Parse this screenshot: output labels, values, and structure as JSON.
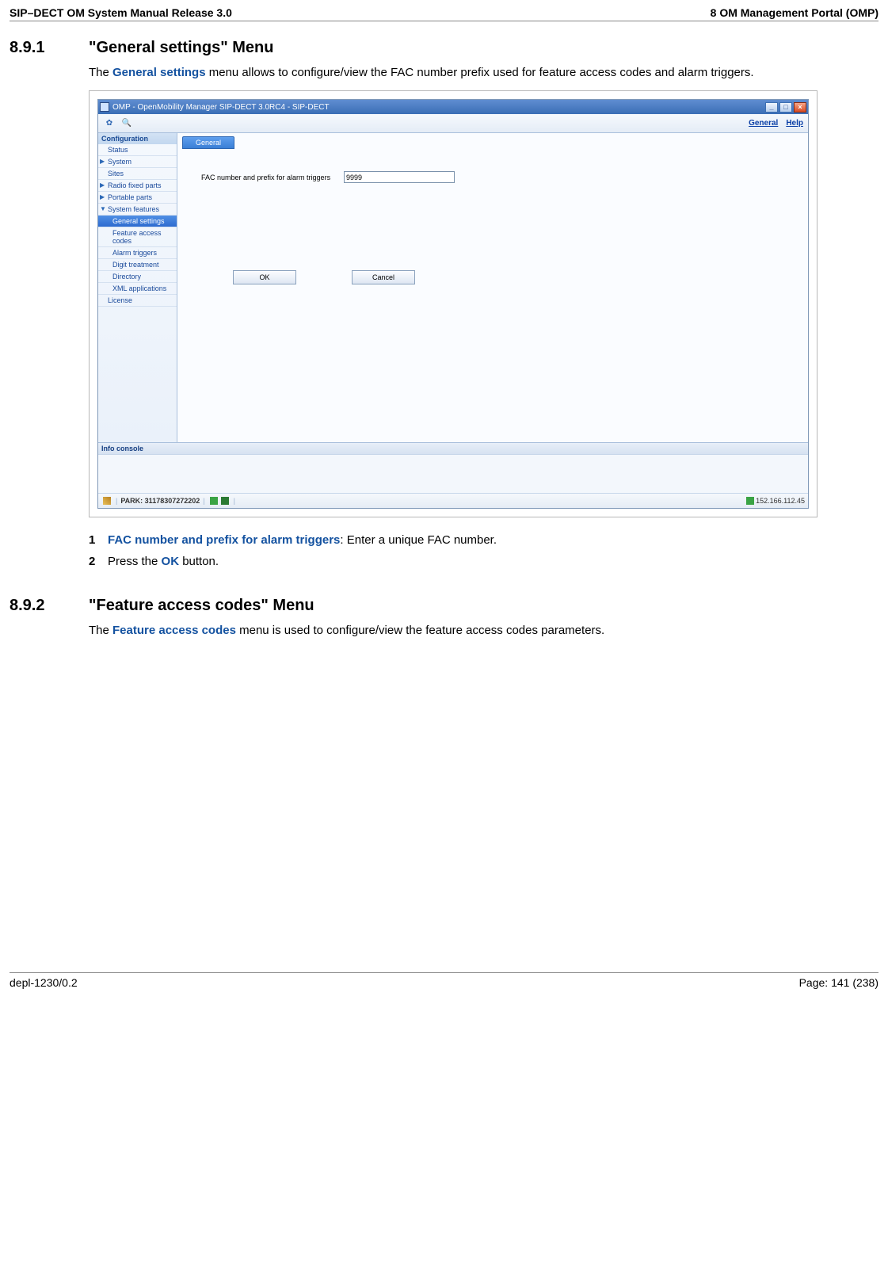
{
  "header": {
    "left": "SIP–DECT OM System Manual Release 3.0",
    "right": "8 OM Management Portal (OMP)"
  },
  "section1": {
    "num": "8.9.1",
    "title": "\"General settings\" Menu",
    "intro_prefix": "The ",
    "intro_bold": "General settings",
    "intro_suffix": " menu allows to configure/view the FAC number prefix used for feature access codes and alarm triggers."
  },
  "screenshot": {
    "window_title": "OMP - OpenMobility Manager SIP-DECT 3.0RC4 - SIP-DECT",
    "toolbar_links": {
      "general": "General",
      "help": "Help"
    },
    "sidebar": {
      "header": "Configuration",
      "items": [
        {
          "label": "Status",
          "level": 1
        },
        {
          "label": "System",
          "level": 1,
          "arrow": true
        },
        {
          "label": "Sites",
          "level": 1
        },
        {
          "label": "Radio fixed parts",
          "level": 1,
          "arrow": true
        },
        {
          "label": "Portable parts",
          "level": 1,
          "arrow": true
        },
        {
          "label": "System features",
          "level": 1,
          "arrow_down": true
        },
        {
          "label": "General settings",
          "level": 2,
          "selected": true
        },
        {
          "label": "Feature access codes",
          "level": 2
        },
        {
          "label": "Alarm triggers",
          "level": 2
        },
        {
          "label": "Digit treatment",
          "level": 2
        },
        {
          "label": "Directory",
          "level": 2
        },
        {
          "label": "XML applications",
          "level": 2
        },
        {
          "label": "License",
          "level": 1
        }
      ]
    },
    "tab": "General",
    "form": {
      "fac_label": "FAC number and prefix for alarm triggers",
      "fac_value": "9999"
    },
    "buttons": {
      "ok": "OK",
      "cancel": "Cancel"
    },
    "info_console": "Info console",
    "status": {
      "park_label": "PARK: 31178307272202",
      "ip": "152.166.112.45"
    }
  },
  "steps1": [
    {
      "num": "1",
      "bold": "FAC number and prefix for alarm triggers",
      "after": ": Enter a unique FAC number."
    },
    {
      "num": "2",
      "before": "Press the ",
      "bold": "OK",
      "after": " button."
    }
  ],
  "section2": {
    "num": "8.9.2",
    "title": "\"Feature access codes\" Menu",
    "intro_prefix": "The ",
    "intro_bold": "Feature access codes",
    "intro_suffix": " menu is used to configure/view the feature access codes parameters."
  },
  "footer": {
    "left": "depl-1230/0.2",
    "right": "Page: 141 (238)"
  }
}
